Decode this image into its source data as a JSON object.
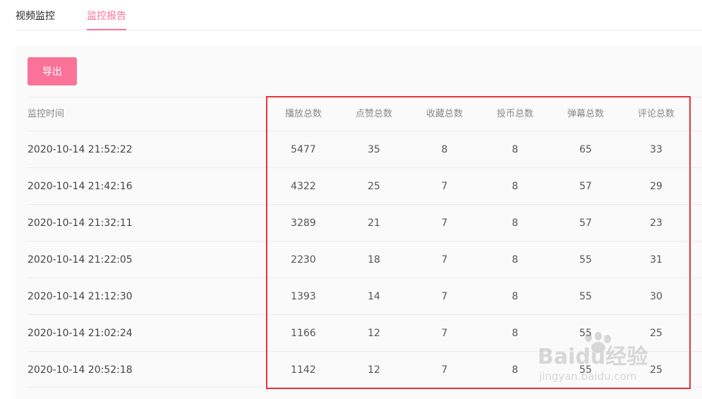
{
  "tabs": [
    {
      "label": "视频监控",
      "active": false
    },
    {
      "label": "监控报告",
      "active": true
    }
  ],
  "toolbar": {
    "export_label": "导出"
  },
  "table": {
    "headers": [
      "监控时间",
      "播放总数",
      "点赞总数",
      "收藏总数",
      "投币总数",
      "弹幕总数",
      "评论总数"
    ],
    "rows": [
      [
        "2020-10-14 21:52:22",
        "5477",
        "35",
        "8",
        "8",
        "65",
        "33"
      ],
      [
        "2020-10-14 21:42:16",
        "4322",
        "25",
        "7",
        "8",
        "57",
        "29"
      ],
      [
        "2020-10-14 21:32:11",
        "3289",
        "21",
        "7",
        "8",
        "57",
        "23"
      ],
      [
        "2020-10-14 21:22:05",
        "2230",
        "18",
        "7",
        "8",
        "55",
        "31"
      ],
      [
        "2020-10-14 21:12:30",
        "1393",
        "14",
        "7",
        "8",
        "55",
        "30"
      ],
      [
        "2020-10-14 21:02:24",
        "1166",
        "12",
        "7",
        "8",
        "55",
        "25"
      ],
      [
        "2020-10-14 20:52:18",
        "1142",
        "12",
        "7",
        "8",
        "55",
        "25"
      ]
    ]
  },
  "watermark": {
    "brand": "Baidu经验",
    "url": "jingyan.baidu.com"
  },
  "colors": {
    "accent": "#fb7299",
    "highlight": "#e8333b"
  }
}
